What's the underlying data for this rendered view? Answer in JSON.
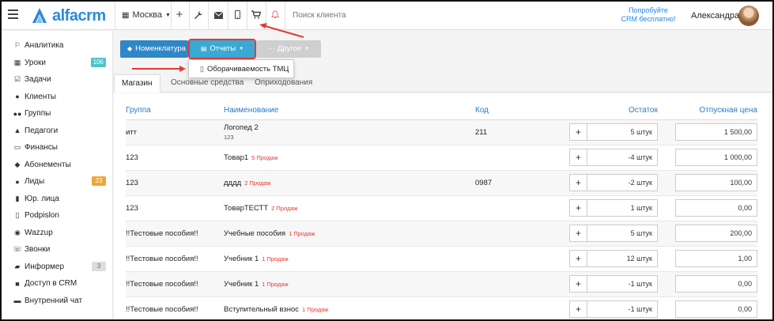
{
  "header": {
    "logo_text": "alfacrm",
    "branch": "Москва",
    "search_placeholder": "Поиск клиента",
    "promo_line1": "Попробуйте",
    "promo_line2": "CRM бесплатно!",
    "user_name": "Александра",
    "icons": [
      "plus-icon",
      "wrench-icon",
      "mail-icon",
      "mobile-icon",
      "cart-icon",
      "bell-icon"
    ]
  },
  "sidebar": {
    "items": [
      {
        "label": "Аналитика",
        "icon": "map-icon",
        "glyph": "⚐"
      },
      {
        "label": "Уроки",
        "icon": "calendar-icon",
        "glyph": "▦",
        "badge": "106",
        "badge_color": "#4fc3c9"
      },
      {
        "label": "Задачи",
        "icon": "clipboard-icon",
        "glyph": "☑"
      },
      {
        "label": "Клиенты",
        "icon": "user-icon",
        "glyph": "●"
      },
      {
        "label": "Группы",
        "icon": "users-icon",
        "glyph": "●●"
      },
      {
        "label": "Педагоги",
        "icon": "graduation-cap-icon",
        "glyph": "▲"
      },
      {
        "label": "Финансы",
        "icon": "money-icon",
        "glyph": "▭"
      },
      {
        "label": "Абонементы",
        "icon": "ticket-icon",
        "glyph": "◆"
      },
      {
        "label": "Лиды",
        "icon": "user-plus-icon",
        "glyph": "●",
        "badge": "23",
        "badge_color": "#f0a53a"
      },
      {
        "label": "Юр. лица",
        "icon": "building-icon",
        "glyph": "▮"
      },
      {
        "label": "Podpislon",
        "icon": "document-icon",
        "glyph": "▯"
      },
      {
        "label": "Wazzup",
        "icon": "whatsapp-icon",
        "glyph": "◉"
      },
      {
        "label": "Звонки",
        "icon": "phone-icon",
        "glyph": "☏"
      },
      {
        "label": "Информер",
        "icon": "book-icon",
        "glyph": "▰",
        "badge": "3",
        "badge_color": "#dddddd"
      },
      {
        "label": "Доступ в CRM",
        "icon": "lock-icon",
        "glyph": "■"
      },
      {
        "label": "Внутренний чат",
        "icon": "chat-icon",
        "glyph": "▬"
      }
    ]
  },
  "toolbar": {
    "nomenclature": "Номенклатура",
    "reports": "Отчеты",
    "other": "··· Другое",
    "dropdown_item": "Оборачиваемость ТМЦ"
  },
  "tabs": [
    "Магазин",
    "Основные средства",
    "Оприходования"
  ],
  "table": {
    "headers": [
      "Группа",
      "Наименование",
      "Код",
      "Остаток",
      "Отпускная цена"
    ],
    "rows": [
      {
        "group": "итт",
        "name": "Логопед 2",
        "sub": "123",
        "sales": "",
        "code": "211",
        "stock": "5 штук",
        "price": "1 500,00"
      },
      {
        "group": "123",
        "name": "Товар1",
        "sub": "",
        "sales": "5 Продаж",
        "code": "",
        "stock": "-4 штук",
        "price": "1 000,00"
      },
      {
        "group": "123",
        "name": "дддд",
        "sub": "",
        "sales": "2 Продаж",
        "code": "0987",
        "stock": "-2 штук",
        "price": "100,00"
      },
      {
        "group": "123",
        "name": "ТоварТЕСТТ",
        "sub": "",
        "sales": "2 Продаж",
        "code": "",
        "stock": "1 штук",
        "price": "0,00"
      },
      {
        "group": "!!Тестовые пособия!!",
        "name": "Учебные пособия",
        "sub": "",
        "sales": "1 Продаж",
        "code": "",
        "stock": "5 штук",
        "price": "200,00"
      },
      {
        "group": "!!Тестовые пособия!!",
        "name": "Учебник 1",
        "sub": "",
        "sales": "1 Продаж",
        "code": "",
        "stock": "12 штук",
        "price": "1,00"
      },
      {
        "group": "!!Тестовые пособия!!",
        "name": "Учебник 1",
        "sub": "",
        "sales": "1 Продаж",
        "code": "",
        "stock": "-1 штук",
        "price": "0,00"
      },
      {
        "group": "!!Тестовые пособия!!",
        "name": "Вступительный взнос",
        "sub": "",
        "sales": "1 Продаж",
        "code": "",
        "stock": "-1 штук",
        "price": "0,00"
      }
    ]
  },
  "colors": {
    "accent": "#2f87c8",
    "header_text": "#2b7bc0",
    "annotation": "#e53935",
    "brand": "#2a8bd9"
  }
}
